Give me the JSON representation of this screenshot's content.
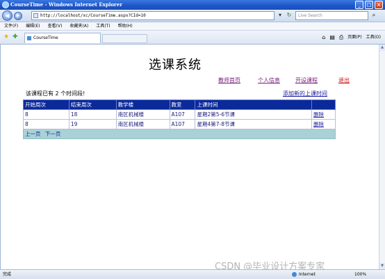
{
  "window": {
    "title": "CourseTime - Windows Internet Explorer"
  },
  "browser": {
    "url": "http://localhost/xc/CourseTime.aspx?CId=10",
    "search_placeholder": "Live Search",
    "menu": [
      "文件(F)",
      "编辑(E)",
      "查看(V)",
      "收藏夹(A)",
      "工具(T)",
      "帮助(H)"
    ],
    "tab_title": "CourseTime",
    "commands": {
      "page": "页面(P)",
      "tools": "工具(O)"
    },
    "status": {
      "done": "完成",
      "zone": "Internet",
      "zoom": "100%"
    }
  },
  "page": {
    "title": "选课系统",
    "nav": [
      "教师首页",
      "个人信息",
      "开设课程",
      "退出"
    ],
    "count_text": "该课程已有 2 个时间段!",
    "add_link": "添加新的上课时间",
    "table": {
      "headers": [
        "开始周次",
        "结束周次",
        "教学楼",
        "教室",
        "上课时间",
        ""
      ],
      "rows": [
        [
          "8",
          "18",
          "南区机械楼",
          "A107",
          "星期2第5-6节课",
          "删除"
        ],
        [
          "8",
          "19",
          "南区机械楼",
          "A107",
          "星期4第7-8节课",
          "删除"
        ]
      ],
      "pager": {
        "prev": "上一页",
        "next": "下一页"
      }
    }
  },
  "watermark": "CSDN @毕业设计方案专家"
}
